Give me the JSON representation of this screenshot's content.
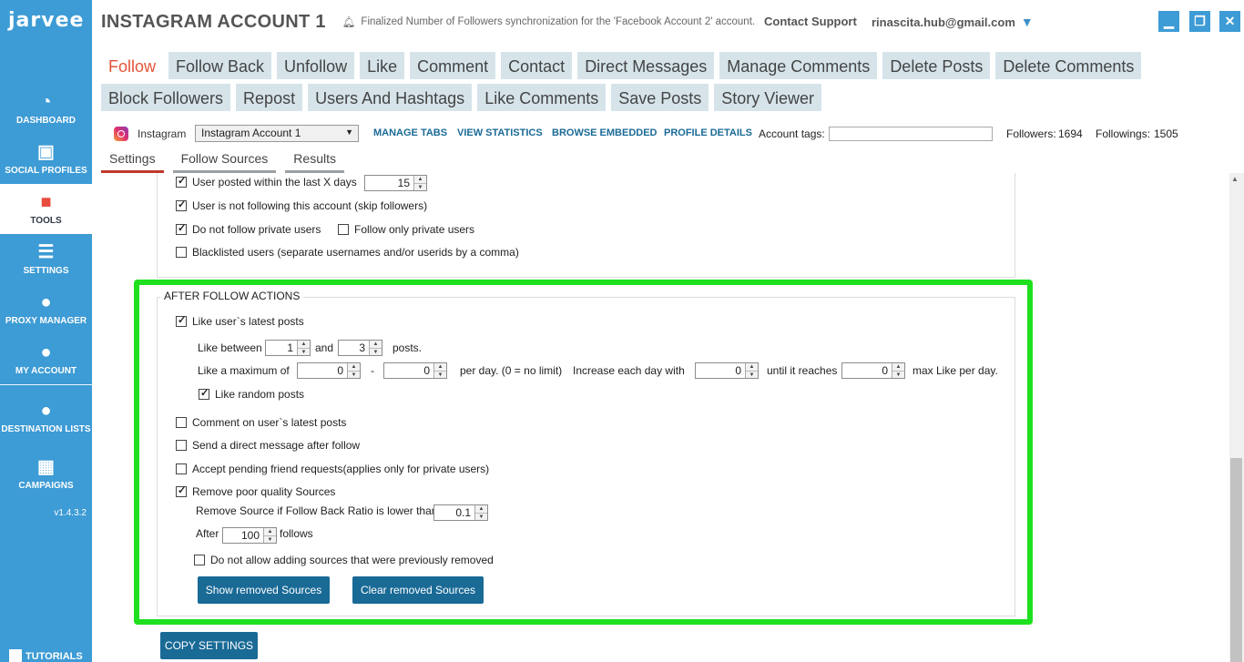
{
  "sidebar": {
    "logo": "jarvee",
    "items": [
      {
        "label": "DASHBOARD",
        "icon": "dashboard-icon",
        "glyph": "◔"
      },
      {
        "label": "SOCIAL PROFILES",
        "icon": "social-profiles-icon",
        "glyph": "▣"
      },
      {
        "label": "TOOLS",
        "icon": "tools-icon",
        "glyph": "■"
      },
      {
        "label": "SETTINGS",
        "icon": "settings-icon",
        "glyph": "☰"
      },
      {
        "label": "PROXY MANAGER",
        "icon": "proxy-manager-icon",
        "glyph": "●"
      },
      {
        "label": "MY ACCOUNT",
        "icon": "my-account-icon",
        "glyph": "●"
      },
      {
        "label": "DESTINATION LISTS",
        "icon": "destination-lists-icon",
        "glyph": "●"
      },
      {
        "label": "CAMPAIGNS",
        "icon": "campaigns-icon",
        "glyph": "▦"
      }
    ],
    "version": "v1.4.3.2",
    "tutorials": "TUTORIALS"
  },
  "titlebar": {
    "title": "INSTAGRAM ACCOUNT 1",
    "notification": "Finalized Number of Followers synchronization for the 'Facebook Account 2' account.",
    "contact": "Contact Support",
    "email": "rinascita.hub@gmail.com"
  },
  "tabs": {
    "row1": [
      "Follow",
      "Follow Back",
      "Unfollow",
      "Like",
      "Comment",
      "Contact",
      "Direct Messages",
      "Manage Comments",
      "Delete Posts",
      "Delete Comments"
    ],
    "row2": [
      "Block Followers",
      "Repost",
      "Users And Hashtags",
      "Like Comments",
      "Save Posts",
      "Story Viewer"
    ],
    "active": "Follow"
  },
  "account_bar": {
    "network": "Instagram",
    "selected_account": "Instagram Account 1",
    "links": [
      "MANAGE TABS",
      "VIEW STATISTICS",
      "BROWSE EMBEDDED",
      "PROFILE DETAILS"
    ],
    "tags_label": "Account tags:",
    "followers_label": "Followers:",
    "followers": "1694",
    "followings_label": "Followings:",
    "followings": "1505"
  },
  "subtabs": [
    "Settings",
    "Follow Sources",
    "Results"
  ],
  "filters": {
    "posted_within": {
      "label": "User posted within the last X days",
      "checked": true,
      "value": "15"
    },
    "not_following": {
      "label": "User is not following this account (skip followers)",
      "checked": true
    },
    "no_private": {
      "label": "Do not follow private users",
      "checked": true
    },
    "only_private": {
      "label": "Follow only private users",
      "checked": false
    },
    "blacklisted": {
      "label": "Blacklisted users (separate usernames and/or userids by a comma)",
      "checked": false
    }
  },
  "after_follow": {
    "title": "AFTER FOLLOW ACTIONS",
    "like_latest": {
      "label": "Like user`s latest posts",
      "checked": true
    },
    "like_between_label": "Like between",
    "like_min": "1",
    "and_label": "and",
    "like_max": "3",
    "posts_label": "posts.",
    "like_max_label": "Like a maximum of",
    "max_from": "0",
    "dash": "-",
    "max_to": "0",
    "per_day_label": "per day. (0 = no limit)",
    "increase_label": "Increase each day with",
    "increase": "0",
    "until_label": "until it reaches",
    "until": "0",
    "max_like_label": "max Like per day.",
    "like_random": {
      "label": "Like random posts",
      "checked": true
    },
    "comment_latest": {
      "label": "Comment on user`s latest posts",
      "checked": false
    },
    "send_dm": {
      "label": "Send a direct message after follow",
      "checked": false
    },
    "accept_pending": {
      "label": "Accept pending friend requests(applies only for private users)",
      "checked": false
    },
    "remove_poor": {
      "label": "Remove poor quality Sources",
      "checked": true
    },
    "ratio_label": "Remove Source if Follow Back Ratio is lower than",
    "ratio": "0.1",
    "after_label": "After",
    "after": "100",
    "follows_label": "follows",
    "no_readd": {
      "label": "Do not allow adding sources that were previously removed",
      "checked": false
    },
    "show_removed": "Show removed Sources",
    "clear_removed": "Clear removed Sources"
  },
  "copy_settings": "COPY SETTINGS"
}
